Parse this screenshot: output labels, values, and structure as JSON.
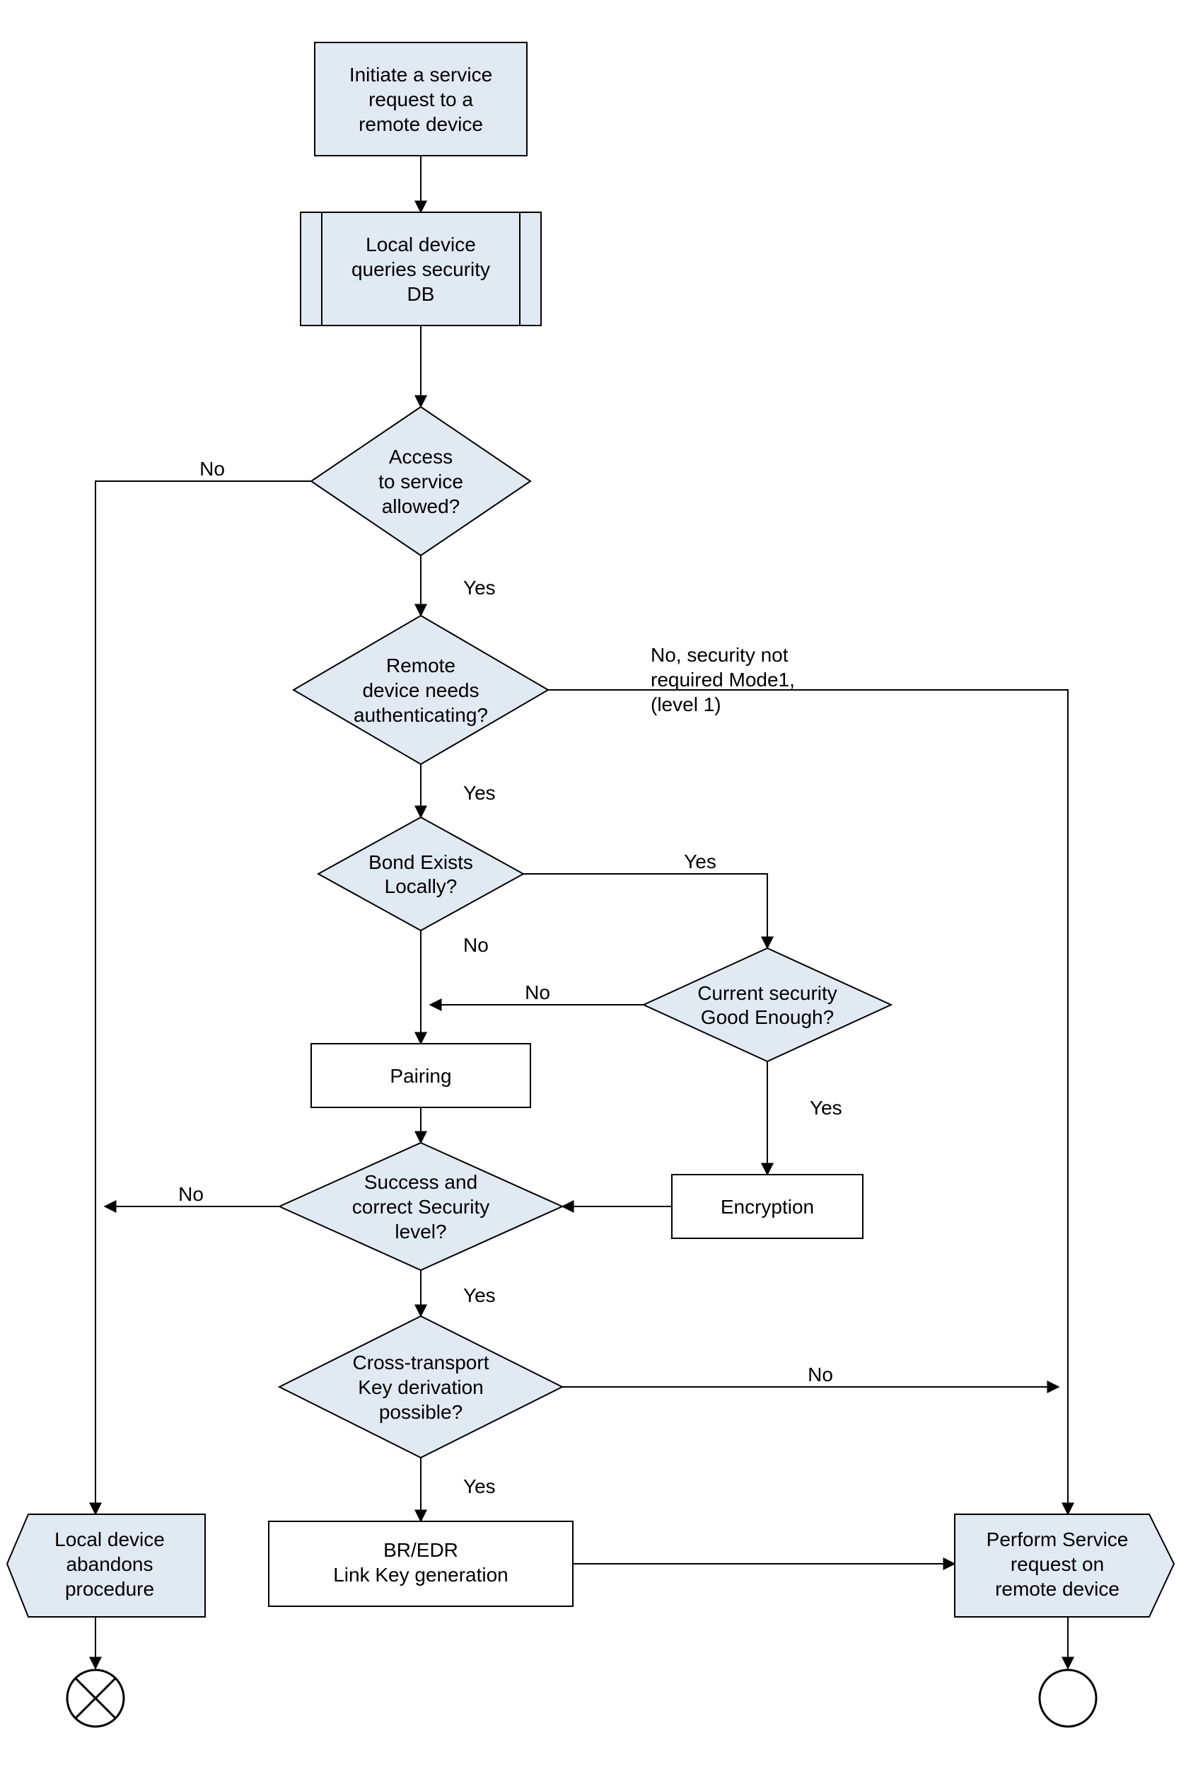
{
  "chart_data": {
    "type": "flowchart",
    "nodes": [
      {
        "id": "n1",
        "kind": "process",
        "label": "Initiate a service request to a remote device"
      },
      {
        "id": "n2",
        "kind": "predefined",
        "label": "Local device queries security DB"
      },
      {
        "id": "d1",
        "kind": "decision",
        "label": "Access to service allowed?"
      },
      {
        "id": "d2",
        "kind": "decision",
        "label": "Remote device needs authenticating?"
      },
      {
        "id": "d3",
        "kind": "decision",
        "label": "Bond Exists Locally?"
      },
      {
        "id": "d4",
        "kind": "decision",
        "label": "Current security Good Enough?"
      },
      {
        "id": "p1",
        "kind": "process-plain",
        "label": "Pairing"
      },
      {
        "id": "p2",
        "kind": "process-plain",
        "label": "Encryption"
      },
      {
        "id": "d5",
        "kind": "decision",
        "label": "Success and correct Security level?"
      },
      {
        "id": "d6",
        "kind": "decision",
        "label": "Cross-transport Key derivation possible?"
      },
      {
        "id": "p3",
        "kind": "process-plain",
        "label": "BR/EDR Link Key generation"
      },
      {
        "id": "t1",
        "kind": "terminator-l",
        "label": "Local device abandons procedure"
      },
      {
        "id": "t2",
        "kind": "terminator-r",
        "label": "Perform Service request on remote device"
      },
      {
        "id": "c1",
        "kind": "connector-x",
        "label": ""
      },
      {
        "id": "c2",
        "kind": "connector-o",
        "label": ""
      }
    ],
    "edges": [
      {
        "from": "n1",
        "to": "n2"
      },
      {
        "from": "n2",
        "to": "d1"
      },
      {
        "from": "d1",
        "to": "d2",
        "label": "Yes"
      },
      {
        "from": "d1",
        "to": "t1",
        "label": "No"
      },
      {
        "from": "d2",
        "to": "d3",
        "label": "Yes"
      },
      {
        "from": "d2",
        "to": "t2",
        "label": "No, security not required Mode1, (level 1)"
      },
      {
        "from": "d3",
        "to": "p1",
        "label": "No"
      },
      {
        "from": "d3",
        "to": "d4",
        "label": "Yes"
      },
      {
        "from": "d4",
        "to": "p1",
        "label": "No"
      },
      {
        "from": "d4",
        "to": "p2",
        "label": "Yes"
      },
      {
        "from": "p1",
        "to": "d5"
      },
      {
        "from": "p2",
        "to": "d5"
      },
      {
        "from": "d5",
        "to": "d6",
        "label": "Yes"
      },
      {
        "from": "d5",
        "to": "t1",
        "label": "No"
      },
      {
        "from": "d6",
        "to": "p3",
        "label": "Yes"
      },
      {
        "from": "d6",
        "to": "t2",
        "label": "No"
      },
      {
        "from": "p3",
        "to": "t2"
      },
      {
        "from": "t1",
        "to": "c1"
      },
      {
        "from": "t2",
        "to": "c2"
      }
    ]
  },
  "nodes": {
    "n1": {
      "l1": "Initiate a service",
      "l2": "request to a",
      "l3": "remote device"
    },
    "n2": {
      "l1": "Local device",
      "l2": "queries security",
      "l3": "DB"
    },
    "d1": {
      "l1": "Access",
      "l2": "to service",
      "l3": "allowed?"
    },
    "d2": {
      "l1": "Remote",
      "l2": "device needs",
      "l3": "authenticating?"
    },
    "d3": {
      "l1": "Bond Exists",
      "l2": "Locally?"
    },
    "d4": {
      "l1": "Current security",
      "l2": "Good Enough?"
    },
    "p1": {
      "l1": "Pairing"
    },
    "p2": {
      "l1": "Encryption"
    },
    "d5": {
      "l1": "Success and",
      "l2": "correct Security",
      "l3": "level?"
    },
    "d6": {
      "l1": "Cross-transport",
      "l2": "Key derivation",
      "l3": "possible?"
    },
    "p3": {
      "l1": "BR/EDR",
      "l2": "Link Key generation"
    },
    "t1": {
      "l1": "Local device",
      "l2": "abandons",
      "l3": "procedure"
    },
    "t2": {
      "l1": "Perform Service",
      "l2": "request on",
      "l3": "remote device"
    }
  },
  "labels": {
    "yes": "Yes",
    "no": "No",
    "d2no_l1": "No, security not",
    "d2no_l2": "required Mode1,",
    "d2no_l3": "(level 1)"
  }
}
